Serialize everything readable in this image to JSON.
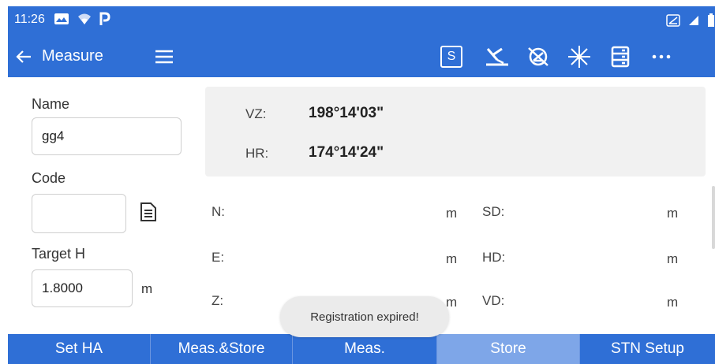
{
  "status": {
    "time": "11:26"
  },
  "toolbar": {
    "title": "Measure",
    "s_label": "S"
  },
  "form": {
    "name_label": "Name",
    "name_value": "gg4",
    "code_label": "Code",
    "code_value": "",
    "target_h_label": "Target H",
    "target_h_value": "1.8000",
    "target_h_unit": "m"
  },
  "angles": {
    "vz_label": "VZ:",
    "vz_value": "198°14'03\"",
    "hr_label": "HR:",
    "hr_value": "174°14'24\""
  },
  "coords": {
    "n_label": "N:",
    "n_unit": "m",
    "e_label": "E:",
    "e_unit": "m",
    "z_label": "Z:",
    "z_unit": "m",
    "sd_label": "SD:",
    "sd_unit": "m",
    "hd_label": "HD:",
    "hd_unit": "m",
    "vd_label": "VD:",
    "vd_unit": "m"
  },
  "toast": "Registration expired!",
  "tabs": [
    "Set HA",
    "Meas.&Store",
    "Meas.",
    "Store",
    "STN Setup"
  ],
  "active_tab": "Store",
  "colors": {
    "primary": "#2f6fd6",
    "active_tab": "#7ea6e8",
    "panel": "#f1f1f1"
  },
  "icons": {
    "status_left": [
      "gallery-icon",
      "wifi-icon",
      "parking-icon"
    ],
    "status_right": [
      "sim-icon",
      "signal-icon",
      "battery-icon"
    ],
    "toolbar_tools": [
      "s-mode-icon",
      "laser-plummet-icon",
      "no-prism-icon",
      "star-burst-icon",
      "data-list-icon",
      "more-icon"
    ]
  }
}
